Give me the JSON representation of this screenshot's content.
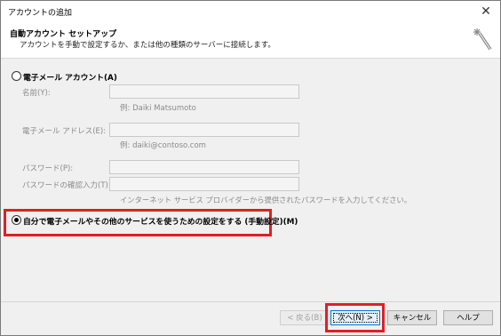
{
  "window": {
    "title": "アカウントの追加"
  },
  "header": {
    "title": "自動アカウント セットアップ",
    "subtitle": "アカウントを手動で設定するか、または他の種類のサーバーに接続します。"
  },
  "email_account": {
    "option_label": "電子メール アカウント(A)",
    "selected": false,
    "name_label": "名前(Y):",
    "name_value": "",
    "name_example": "例: Daiki Matsumoto",
    "email_label": "電子メール アドレス(E):",
    "email_value": "",
    "email_example": "例: daiki@contoso.com",
    "password_label": "パスワード(P):",
    "password_confirm_label": "パスワードの確認入力(T):",
    "password_hint": "インターネット サービス プロバイダーから提供されたパスワードを入力してください。"
  },
  "manual_setup": {
    "option_label": "自分で電子メールやその他のサービスを使うための設定をする (手動設定)(M)",
    "selected": true
  },
  "footer": {
    "back_label": "< 戻る(B)",
    "next_label": "次へ(N) >",
    "cancel_label": "キャンセル",
    "help_label": "ヘルプ"
  },
  "icons": {
    "close": "close-icon",
    "wizard": "wizard-sparkle-icon"
  },
  "colors": {
    "highlight": "#e02020",
    "primary_border": "#0078d7"
  }
}
